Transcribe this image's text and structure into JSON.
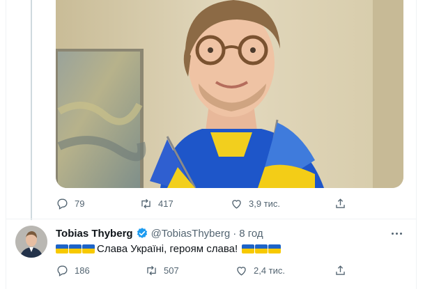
{
  "tweet_one": {
    "actions": {
      "reply_count": "79",
      "retweet_count": "417",
      "like_count": "3,9 тис."
    }
  },
  "tweet_two": {
    "author_name": "Tobias Thyberg",
    "handle": "@TobiasThyberg",
    "separator": "·",
    "time": "8 год",
    "text": "Слава Україні, героям слава!",
    "actions": {
      "reply_count": "186",
      "retweet_count": "507",
      "like_count": "2,4 тис."
    }
  },
  "colors": {
    "secondary_text": "#536471",
    "verified": "#1d9bf0",
    "flag_blue": "#1d64c8",
    "flag_yellow": "#f7c900"
  },
  "icons": [
    "reply-icon",
    "retweet-icon",
    "like-icon",
    "share-icon",
    "verified-badge-icon",
    "more-icon"
  ]
}
